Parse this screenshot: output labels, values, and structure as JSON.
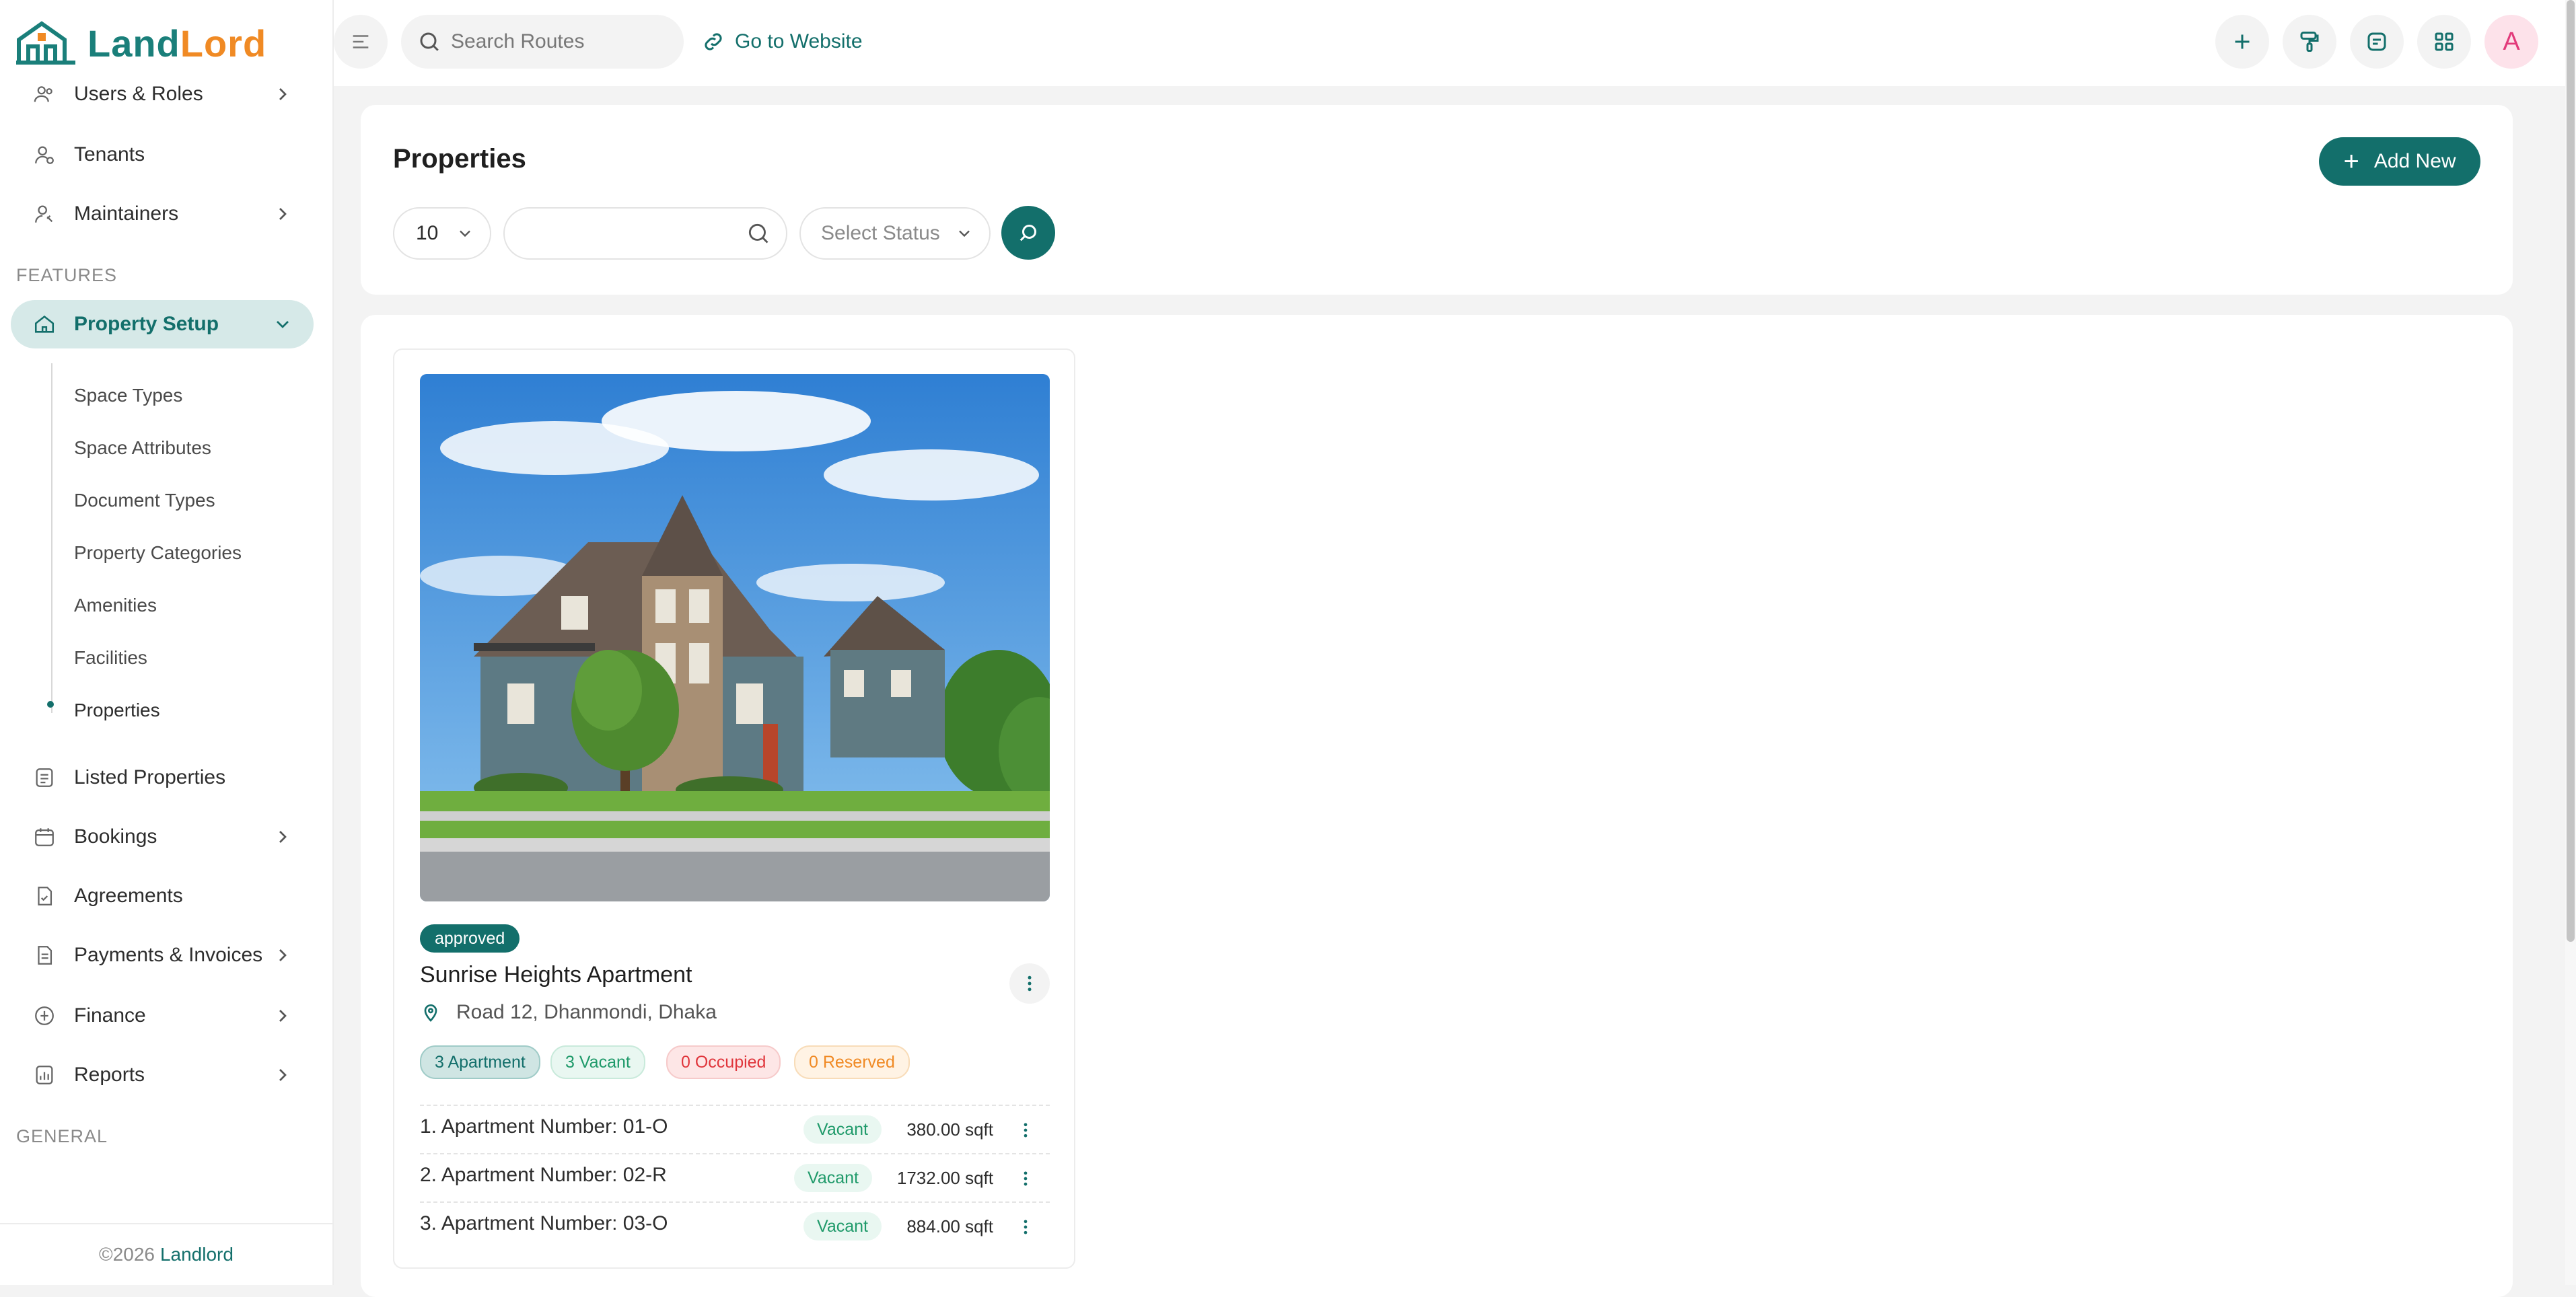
{
  "brand": {
    "part1": "Land",
    "part2": "Lord"
  },
  "sidebar": {
    "items_top": [
      {
        "label": "Users & Roles",
        "icon": "users-icon",
        "has_chevron": true
      },
      {
        "label": "Tenants",
        "icon": "tenant-icon",
        "has_chevron": false
      },
      {
        "label": "Maintainers",
        "icon": "maintainer-icon",
        "has_chevron": true
      }
    ],
    "section_features": "FEATURES",
    "property_setup": {
      "label": "Property Setup",
      "icon": "home-icon"
    },
    "sub_items": [
      "Space Types",
      "Space Attributes",
      "Document Types",
      "Property Categories",
      "Amenities",
      "Facilities",
      "Properties"
    ],
    "items_bottom": [
      {
        "label": "Listed Properties",
        "icon": "list-icon",
        "has_chevron": false
      },
      {
        "label": "Bookings",
        "icon": "calendar-icon",
        "has_chevron": true
      },
      {
        "label": "Agreements",
        "icon": "agreement-icon",
        "has_chevron": false
      },
      {
        "label": "Payments & Invoices",
        "icon": "invoice-icon",
        "has_chevron": true
      },
      {
        "label": "Finance",
        "icon": "finance-icon",
        "has_chevron": true
      },
      {
        "label": "Reports",
        "icon": "report-icon",
        "has_chevron": true
      }
    ],
    "section_general": "GENERAL",
    "footer": {
      "copyright": "©2026",
      "brand": "Landlord"
    }
  },
  "topbar": {
    "search_placeholder": "Search Routes",
    "goto_label": "Go to Website",
    "avatar_letter": "A"
  },
  "page": {
    "title": "Properties",
    "add_button": "Add New",
    "per_page": "10",
    "status_placeholder": "Select Status"
  },
  "property": {
    "status": "approved",
    "name": "Sunrise Heights Apartment",
    "address": "Road 12, Dhanmondi, Dhaka",
    "tags": {
      "apartments": "3 Apartment",
      "vacant": "3 Vacant",
      "occupied": "0 Occupied",
      "reserved": "0 Reserved"
    },
    "units": [
      {
        "label": "1. Apartment Number: 01-O",
        "status": "Vacant",
        "size": "380.00 sqft"
      },
      {
        "label": "2. Apartment Number: 02-R",
        "status": "Vacant",
        "size": "1732.00 sqft"
      },
      {
        "label": "3. Apartment Number: 03-O",
        "status": "Vacant",
        "size": "884.00 sqft"
      }
    ]
  },
  "colors": {
    "primary": "#136f6b",
    "accent": "#f08a24",
    "active_bg": "#d6e9e8"
  }
}
